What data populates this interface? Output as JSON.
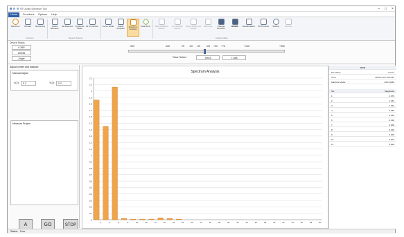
{
  "window": {
    "title": "NTI Audio Spectrum Tool",
    "controls": [
      "–",
      "□",
      "×"
    ]
  },
  "tabs": [
    {
      "label": "Home",
      "active": true
    },
    {
      "label": "Functions",
      "active": false
    },
    {
      "label": "Options",
      "active": false
    },
    {
      "label": "Help",
      "active": false
    }
  ],
  "ribbon": {
    "buttons": [
      {
        "label": "Spectrum",
        "icon": "circle-icon",
        "selected": false
      },
      {
        "label": "Vibrator",
        "icon": "wave-icon",
        "selected": false
      },
      {
        "label": "Rendering",
        "icon": "edit-icon",
        "selected": false
      },
      {
        "label": "Read Element",
        "icon": "read-icon",
        "selected": false
      },
      {
        "label": "Set Element",
        "icon": "set-icon",
        "selected": false
      },
      {
        "label": "Synthesis Mode",
        "icon": "ab-icon",
        "selected": false
      },
      {
        "label": "Fit Correction",
        "icon": "fit-icon",
        "selected": false
      },
      {
        "label": "Curve Scale",
        "icon": "curve-icon",
        "selected": false
      },
      {
        "label": "Profile Analysis",
        "icon": "profile-icon",
        "selected": false
      },
      {
        "label": "Spectrum Analysis",
        "icon": "spectrum-icon",
        "selected": true
      },
      {
        "label": "Peak Find",
        "icon": "diamond-icon",
        "selected": false
      },
      {
        "label": "SGE Standard Report",
        "icon": "report-icon",
        "selected": false
      },
      {
        "label": "SG Statistic Report",
        "icon": "stats-icon",
        "selected": false
      },
      {
        "label": "Wave Width and Height",
        "icon": "wave-width-icon",
        "selected": false
      },
      {
        "label": "Warnings",
        "icon": "warning-icon",
        "selected": false
      },
      {
        "label": "Change Direction",
        "icon": "direction-icon",
        "selected": false
      },
      {
        "label": "BMBW",
        "icon": "bars-icon",
        "selected": false
      },
      {
        "label": "Recalculation",
        "icon": "recalc-icon",
        "selected": false
      },
      {
        "label": "PN Process",
        "icon": "p-icon",
        "selected": false
      },
      {
        "label": "Setting",
        "icon": "gear-icon",
        "selected": false
      },
      {
        "label": "Restore",
        "icon": "restore-icon",
        "selected": false
      }
    ],
    "groups": [
      "Function",
      "Report Options",
      "Analyze Bars"
    ]
  },
  "tool": {
    "panel_title": "Device Status",
    "status_value": "0.36P",
    "mode_value": "ZX035",
    "angle_label": "Angle",
    "scale_ticks": [
      "-300",
      "-150",
      "-75",
      "-50",
      "-25",
      "+25",
      "+50",
      "+75",
      "+150",
      "+300"
    ],
    "clear_button": "Clear Select",
    "start_value": "395.6",
    "end_value": "7.288"
  },
  "left_panel": {
    "title": "Adjust center and balance",
    "manual_adjust_label": "Manual Adjust",
    "x_label": "X(2):",
    "x_value": "0.2",
    "y_label": "Y(2):",
    "y_value": "0.2",
    "measure_label": "Measure Project",
    "buttons": [
      "A",
      "GO",
      "STOP"
    ]
  },
  "chart_data": {
    "type": "bar",
    "title": "Spectrum Analysis",
    "ylim": [
      0,
      2.2
    ],
    "yticks": [
      0,
      0.1,
      0.2,
      0.3,
      0.4,
      0.5,
      0.6,
      0.7,
      0.8,
      0.9,
      1.0,
      1.1,
      1.2,
      1.3,
      1.4,
      1.5,
      1.6,
      1.7,
      1.8,
      1.9,
      2.0,
      2.1,
      2.2
    ],
    "categories": [
      1,
      2,
      3,
      4,
      5,
      6,
      7,
      8,
      9,
      10,
      11,
      12,
      13,
      14,
      15,
      16,
      17,
      18,
      19,
      20,
      21,
      22,
      23,
      24,
      25,
      26,
      27,
      28,
      29,
      30,
      31,
      32,
      33,
      34,
      35,
      36,
      37,
      38,
      39,
      40,
      41,
      42,
      43,
      44,
      45,
      46,
      47,
      48,
      49,
      50
    ],
    "xtick_labels": [
      "2",
      "4",
      "6",
      "8",
      "10",
      "12",
      "14",
      "16",
      "18",
      "20",
      "22",
      "24",
      "26",
      "28",
      "30",
      "32",
      "34",
      "36",
      "38",
      "40",
      "42",
      "44",
      "46",
      "48",
      "50"
    ],
    "values": [
      1.86,
      0,
      1.45,
      0,
      2.06,
      0,
      0.02,
      0,
      0.01,
      0,
      0.01,
      0,
      0.01,
      0,
      0.03,
      0,
      0.02,
      0,
      0.01,
      0,
      0,
      0,
      0,
      0,
      0,
      0,
      0,
      0,
      0,
      0,
      0,
      0,
      0,
      0,
      0,
      0,
      0,
      0,
      0,
      0,
      0,
      0,
      0,
      0,
      0,
      0,
      0,
      0,
      0,
      0
    ],
    "bar_color": "#f0a54a"
  },
  "right_panel": {
    "header": "KCN",
    "info": [
      {
        "key": "File Name",
        "value": "xxxxxx"
      },
      {
        "key": "Time",
        "value": "2021-11-23 14:14:21"
      },
      {
        "key": "Machine Model",
        "value": "RCF-N180"
      }
    ],
    "col_headers": [
      "SG",
      "Magnitude"
    ],
    "rows": [
      {
        "k": "1",
        "v": "2.079"
      },
      {
        "k": "2",
        "v": "1.464"
      },
      {
        "k": "3",
        "v": "1.632"
      },
      {
        "k": "4",
        "v": "0.459"
      },
      {
        "k": "5",
        "v": "0.029"
      },
      {
        "k": "6",
        "v": "0.018"
      },
      {
        "k": "7",
        "v": "0.008"
      },
      {
        "k": "8",
        "v": "0.015"
      },
      {
        "k": "9",
        "v": "0.005"
      },
      {
        "k": "10",
        "v": "0.003"
      },
      {
        "k": "11",
        "v": "0.008"
      }
    ]
  },
  "status_bar": {
    "label": "Status:",
    "value": "Free"
  },
  "colors": {
    "accent": "#2f5fa8",
    "selected_bg": "#fbdca0",
    "bar": "#f0a54a"
  }
}
